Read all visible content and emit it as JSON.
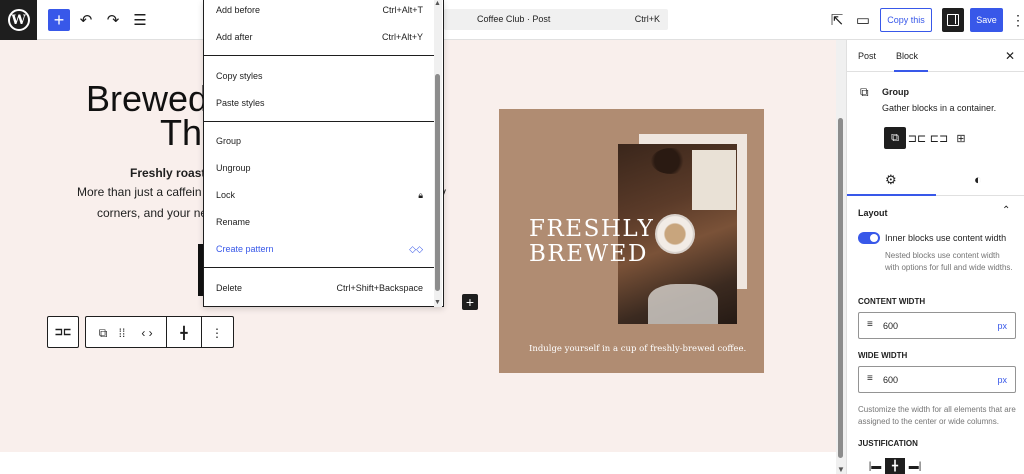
{
  "topbar": {
    "logo": "W",
    "inserter_glyph": "+",
    "undo_glyph": "↶",
    "redo_glyph": "↷",
    "list_view_glyph": "☰",
    "command_title": "Coffee Club · Post",
    "command_shortcut": "Ctrl+K",
    "view_glyph": "⇱",
    "preview_glyph": "▭",
    "copy_this_label": "Copy this",
    "save_label": "Save",
    "more_glyph": "⋮"
  },
  "canvas": {
    "title_line1": "Brewed",
    "title_line2": "Th",
    "subhead": "Freshly roaste",
    "para1": "More than just a caffein",
    "para1_tail": "y",
    "para2": "corners, and your ne",
    "add_block_glyph": "+"
  },
  "block_toolbar": {
    "parent_glyph": "⊐⊏",
    "group_glyph": "⧉",
    "drag_glyph": "⁞⁞",
    "move_glyph": "‹ ›",
    "justify_glyph": "╋",
    "options_glyph": "⋮"
  },
  "card": {
    "headline_line1": "FRESHLY",
    "headline_line2": "BREWED",
    "caption": "Indulge yourself in a cup of freshly-brewed coffee."
  },
  "menu": {
    "items": [
      {
        "label": "Add before",
        "shortcut": "Ctrl+Alt+T"
      },
      {
        "label": "Add after",
        "shortcut": "Ctrl+Alt+Y"
      },
      {
        "label": "Copy styles",
        "shortcut": ""
      },
      {
        "label": "Paste styles",
        "shortcut": ""
      },
      {
        "label": "Group",
        "shortcut": ""
      },
      {
        "label": "Ungroup",
        "shortcut": ""
      },
      {
        "label": "Lock",
        "shortcut": ""
      },
      {
        "label": "Rename",
        "shortcut": ""
      },
      {
        "label": "Create pattern",
        "shortcut": ""
      },
      {
        "label": "Delete",
        "shortcut": "Ctrl+Shift+Backspace"
      }
    ],
    "lock_glyph": "🔒︎",
    "pattern_glyph": "◇◇",
    "scroll_up": "▲",
    "scroll_down": "▼"
  },
  "sidebar": {
    "tab_post": "Post",
    "tab_block": "Block",
    "close_glyph": "✕",
    "block_icon": "⧉",
    "block_name": "Group",
    "block_description": "Gather blocks in a container.",
    "variations": [
      "⧉",
      "⊐⊏",
      "⊏⊐",
      "⊞"
    ],
    "settings_glyph": "⚙",
    "styles_glyph": "◐",
    "layout_title": "Layout",
    "collapse_glyph": "⌃",
    "toggle_label": "Inner blocks use content width",
    "toggle_on": true,
    "toggle_help": "Nested blocks use content width with options for full and wide widths.",
    "content_width_label": "CONTENT WIDTH",
    "content_width_value": "600",
    "content_width_unit": "px",
    "wide_width_label": "WIDE WIDTH",
    "wide_width_value": "600",
    "wide_width_unit": "px",
    "width_help": "Customize the width for all elements that are assigned to the center or wide columns.",
    "justification_label": "JUSTIFICATION",
    "justify_options": [
      "|▬",
      "╋",
      "▬|"
    ],
    "field_icon": "≡"
  },
  "colors": {
    "accent": "#3858e9",
    "canvas_bg": "#f9efec",
    "card_bg": "#b08c72"
  }
}
